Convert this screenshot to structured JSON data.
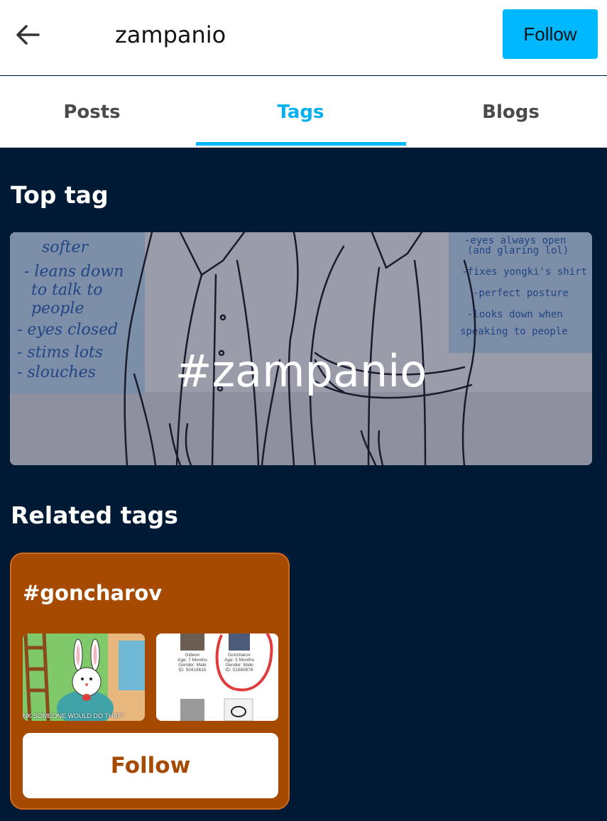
{
  "header": {
    "title": "zampanio",
    "follow_label": "Follow"
  },
  "tabs": [
    {
      "label": "Posts",
      "active": false
    },
    {
      "label": "Tags",
      "active": true
    },
    {
      "label": "Blogs",
      "active": false
    }
  ],
  "top_tag": {
    "section_title": "Top tag",
    "tag": "#zampanio",
    "image_notes_left": [
      "softer",
      "- leans down",
      "to talk to",
      "people",
      "- eyes closed",
      "- stims lots",
      "- slouches"
    ],
    "image_notes_right": [
      "-eyes always open",
      "(and glaring lol)",
      "-fixes yongki's shirt",
      "-perfect posture",
      "-looks down when",
      "speaking to people"
    ]
  },
  "related_tags": {
    "section_title": "Related tags",
    "items": [
      {
        "tag": "#goncharov",
        "thumb1_caption": "NK SOMEONE WOULD DO THAT?",
        "thumb2_profiles": [
          {
            "name": "Gideon",
            "age": "Age: 7 Months",
            "gender": "Gender: Male",
            "id": "ID: 50419615"
          },
          {
            "name": "Goncharov",
            "age": "Age: 5 Months",
            "gender": "Gender: Male",
            "id": "ID: 51580876"
          }
        ],
        "follow_label": "Follow"
      }
    ]
  },
  "colors": {
    "accent": "#00b8ff",
    "background": "#001935",
    "related_card": "#a54a00"
  }
}
